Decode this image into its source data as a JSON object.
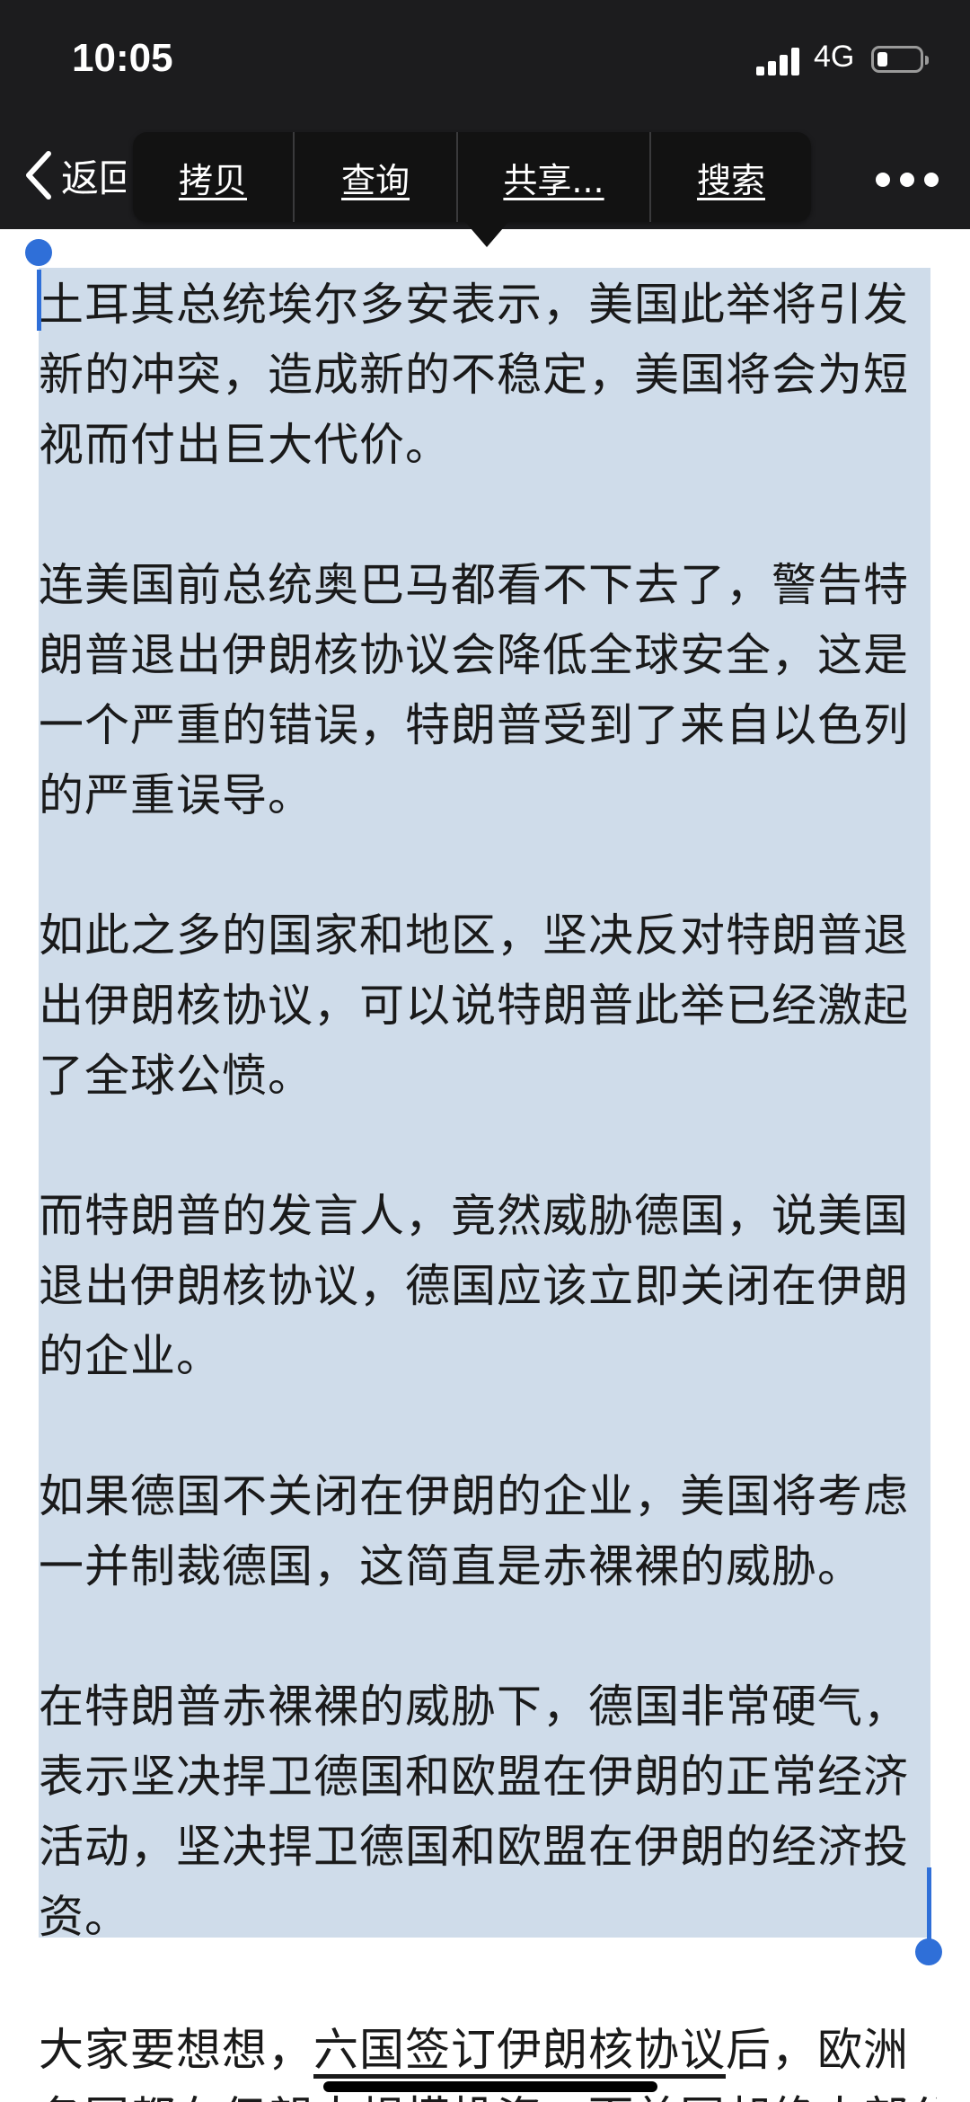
{
  "status_bar": {
    "time": "10:05",
    "network": "4G",
    "battery_level": 0.25
  },
  "nav": {
    "back_label": "返回",
    "more_icon": "ellipsis-icon",
    "back_icon": "chevron-left-icon"
  },
  "context_menu": {
    "items": [
      "拷贝",
      "查询",
      "共享...",
      "搜索"
    ]
  },
  "article": {
    "paragraphs": [
      "土耳其总统埃尔多安表示，美国此举将引发新的冲突，造成新的不稳定，美国将会为短视而付出巨大代价。",
      "连美国前总统奥巴马都看不下去了，警告特朗普退出伊朗核协议会降低全球安全，这是一个严重的错误，特朗普受到了来自以色列的严重误导。",
      "如此之多的国家和地区，坚决反对特朗普退出伊朗核协议，可以说特朗普此举已经激起了全球公愤。",
      "而特朗普的发言人，竟然威胁德国，说美国退出伊朗核协议，德国应该立即关闭在伊朗的企业。",
      "如果德国不关闭在伊朗的企业，美国将考虑一并制裁德国，这简直是赤裸裸的威胁。",
      "在特朗普赤裸裸的威胁下，德国非常硬气，表示坚决捍卫德国和欧盟在伊朗的正常经济活动，坚决捍卫德国和欧盟在伊朗的经济投资。"
    ],
    "after_selection": {
      "prefix": "大家要想想，",
      "link": "六国签订伊朗核协议",
      "suffix": "后，欧洲"
    },
    "cut_line": "各国都在伊朗大规模投资，而美国却绝大部分被"
  },
  "colors": {
    "selection": "#cfdcea",
    "handle": "#2f6fd8",
    "bar": "#1c1c1e"
  }
}
